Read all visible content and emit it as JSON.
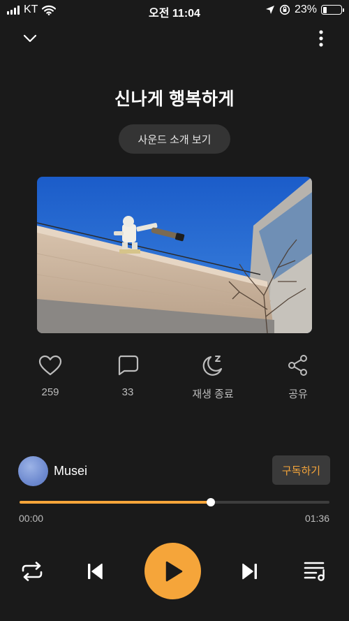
{
  "status_bar": {
    "carrier": "KT",
    "time": "오전 11:04",
    "battery": "23%",
    "battery_level": 0.23
  },
  "header": {
    "title": "신나게 행복하게",
    "intro_button": "사운드 소개 보기"
  },
  "actions": [
    {
      "icon": "heart-icon",
      "label": "259"
    },
    {
      "icon": "comment-icon",
      "label": "33"
    },
    {
      "icon": "sleep-timer-icon",
      "label": "재생 종료"
    },
    {
      "icon": "share-icon",
      "label": "공유"
    }
  ],
  "channel": {
    "name": "Musei",
    "subscribe_label": "구독하기"
  },
  "player": {
    "current_time": "00:00",
    "total_time": "01:36",
    "progress": 0.617,
    "colors": {
      "accent": "#f5a53a",
      "background": "#1a1a1a",
      "track": "#3d3d3d"
    }
  },
  "controls": [
    "repeat-icon",
    "previous-icon",
    "play-icon",
    "next-icon",
    "playlist-icon"
  ]
}
